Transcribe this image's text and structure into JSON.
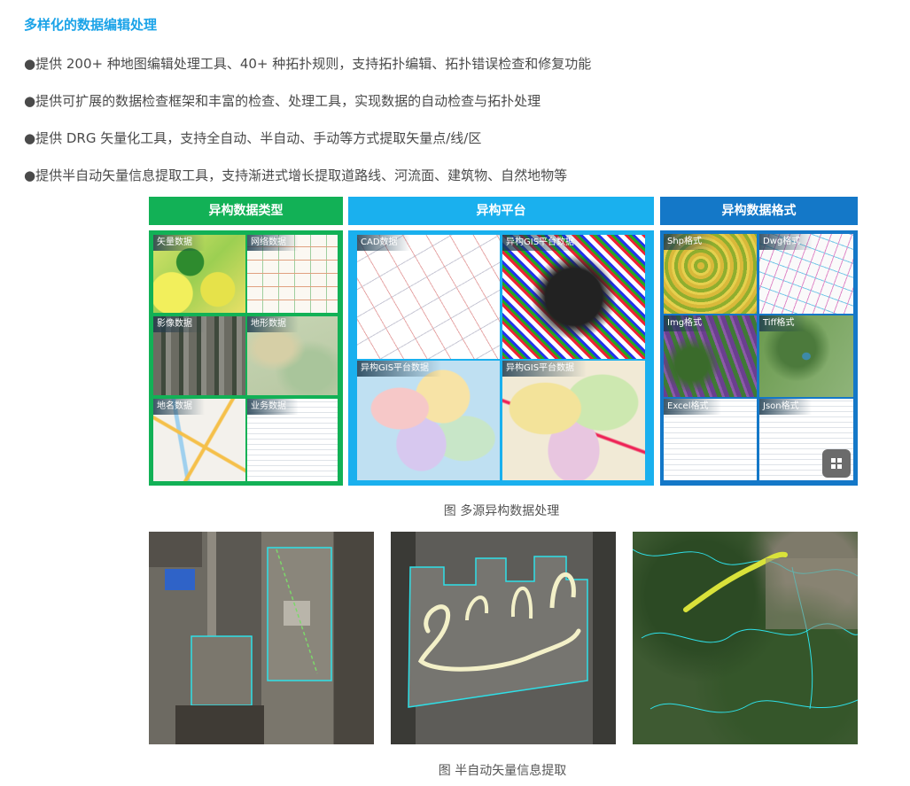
{
  "title": "多样化的数据编辑处理",
  "bullets": [
    "●提供 200+ 种地图编辑处理工具、40+ 种拓扑规则，支持拓扑编辑、拓扑错误检查和修复功能",
    "●提供可扩展的数据检查框架和丰富的检查、处理工具，实现数据的自动检查与拓扑处理",
    "●提供 DRG 矢量化工具，支持全自动、半自动、手动等方式提取矢量点/线/区",
    "●提供半自动矢量信息提取工具，支持渐进式增长提取道路线、河流面、建筑物、自然地物等"
  ],
  "columns": {
    "types": {
      "header": "异构数据类型",
      "tiles": [
        "矢量数据",
        "网络数据",
        "影像数据",
        "地形数据",
        "地名数据",
        "业务数据"
      ]
    },
    "platforms": {
      "header": "异构平台",
      "tiles": [
        "CAD数据",
        "异构GIS平台数据",
        "异构GIS平台数据",
        "异构GIS平台数据"
      ]
    },
    "formats": {
      "header": "异构数据格式",
      "tiles": [
        "Shp格式",
        "Dwg格式",
        "Img格式",
        "Tiff格式",
        "Excel格式",
        "Json格式"
      ]
    }
  },
  "captions": {
    "figure1": "图 多源异构数据处理",
    "figure2": "图 半自动矢量信息提取"
  },
  "colors": {
    "title": "#1aa3e8",
    "types": "#12b156",
    "platforms": "#1ab0ee",
    "formats": "#1478c8",
    "outline_cyan": "#2ee0e8",
    "trace_cream": "#f3f0c8",
    "trace_yellow": "#d9e23a"
  }
}
